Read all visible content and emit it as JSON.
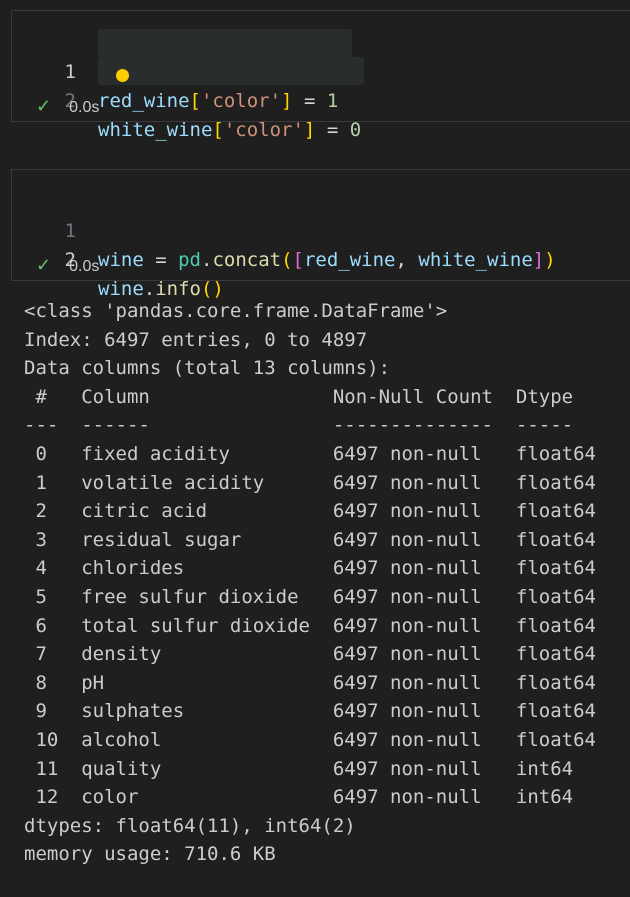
{
  "cells": [
    {
      "line_numbers": [
        "1",
        "2"
      ],
      "lines": [
        {
          "var": "red_wine",
          "open": "[",
          "key": "'color'",
          "close": "]",
          "op": " = ",
          "val": "1"
        },
        {
          "var": "white_wine",
          "open": "[",
          "key": "'color'",
          "close": "]",
          "op": " = ",
          "val": "0"
        }
      ],
      "status_icon": "check-icon",
      "status_glyph": "✓",
      "time": "0.0s"
    },
    {
      "line_numbers": [
        "1",
        "2"
      ],
      "line1": {
        "a": "wine",
        "b": " = ",
        "c": "pd",
        "d": ".",
        "e": "concat",
        "f": "(",
        "g": "[",
        "h": "red_wine",
        "i": ", ",
        "j": "white_wine",
        "k": "]",
        "l": ")"
      },
      "line2": {
        "a": "wine",
        "b": ".",
        "c": "info",
        "d": "()"
      },
      "status_glyph": "✓",
      "time": "0.0s"
    }
  ],
  "output": {
    "lines": [
      "<class 'pandas.core.frame.DataFrame'>",
      "Index: 6497 entries, 0 to 4897",
      "Data columns (total 13 columns):",
      " #   Column                Non-Null Count  Dtype  ",
      "---  ------                --------------  -----  ",
      " 0   fixed acidity         6497 non-null   float64",
      " 1   volatile acidity      6497 non-null   float64",
      " 2   citric acid           6497 non-null   float64",
      " 3   residual sugar        6497 non-null   float64",
      " 4   chlorides             6497 non-null   float64",
      " 5   free sulfur dioxide   6497 non-null   float64",
      " 6   total sulfur dioxide  6497 non-null   float64",
      " 7   density               6497 non-null   float64",
      " 8   pH                    6497 non-null   float64",
      " 9   sulphates             6497 non-null   float64",
      " 10  alcohol               6497 non-null   float64",
      " 11  quality               6497 non-null   int64  ",
      " 12  color                 6497 non-null   int64  ",
      "dtypes: float64(11), int64(2)",
      "memory usage: 710.6 KB"
    ]
  }
}
